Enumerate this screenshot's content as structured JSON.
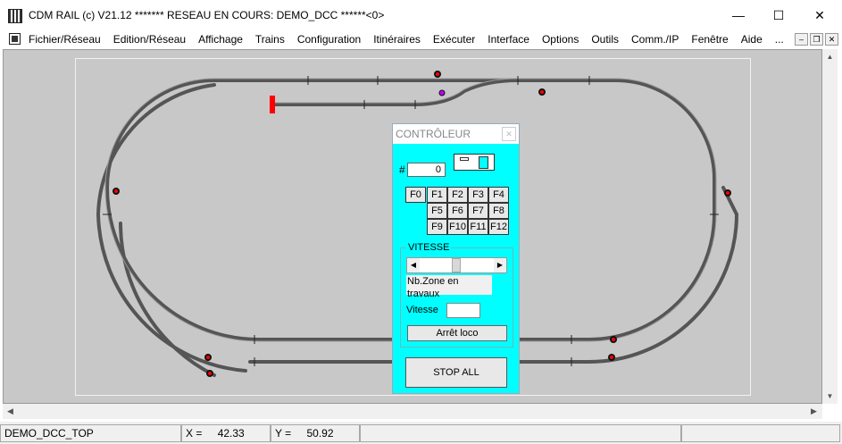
{
  "window": {
    "title": "CDM RAIL (c) V21.12     ******* RESEAU EN COURS: DEMO_DCC ******<0>",
    "minimize": "—",
    "maximize": "☐",
    "close": "✕"
  },
  "menu": {
    "items": [
      "Fichier/Réseau",
      "Edition/Réseau",
      "Affichage",
      "Trains",
      "Configuration",
      "Itinéraires",
      "Exécuter",
      "Interface",
      "Options",
      "Outils",
      "Comm./IP",
      "Fenêtre",
      "Aide",
      "..."
    ],
    "mdi_minimize": "–",
    "mdi_restore": "❐",
    "mdi_close": "✕"
  },
  "controller": {
    "title": "CONTRÔLEUR",
    "close_glyph": "✕",
    "address_label": "#",
    "address_value": "0",
    "function_buttons": [
      "F0",
      "F1",
      "F2",
      "F3",
      "F4",
      "F5",
      "F6",
      "F7",
      "F8",
      "F9",
      "F10",
      "F11",
      "F12"
    ],
    "speed_group_label": "VITESSE",
    "zone_label": "Nb.Zone en travaux",
    "speed_label": "Vitesse",
    "speed_value": "",
    "stop_loco": "Arrêt loco",
    "stop_all": "STOP ALL"
  },
  "status": {
    "layout_name": "DEMO_DCC_TOP",
    "x_label": "X =",
    "x_value": "42.33",
    "y_label": "Y =",
    "y_value": "50.92"
  },
  "colors": {
    "controller_bg": "#00ffff",
    "canvas_bg": "#c8c8c8",
    "track": "#555555",
    "signal_red": "#ff0000",
    "buffer_stop": "#ff0000"
  },
  "icons": {
    "app": "train-app-icon",
    "scroll_left": "◀",
    "scroll_right": "▶",
    "scroll_up": "▲",
    "scroll_down": "▼",
    "slider_left": "◀",
    "slider_right": "▶"
  }
}
